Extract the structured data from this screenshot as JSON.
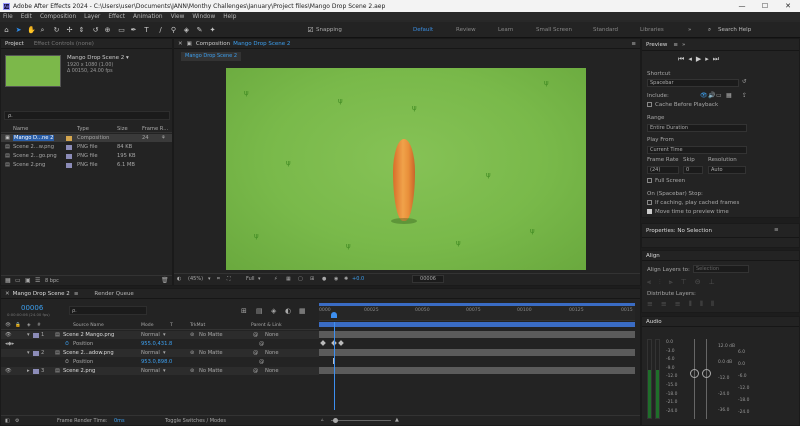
{
  "window": {
    "title": "Adobe After Effects 2024 - C:\\Users\\user\\Documents\\JANN\\Monthy Challenges\\January\\Project files\\Mango Drop Scene 2.aep",
    "app_icon": "Ae",
    "controls": [
      "—",
      "☐",
      "✕"
    ]
  },
  "menu": [
    "File",
    "Edit",
    "Composition",
    "Layer",
    "Effect",
    "Animation",
    "View",
    "Window",
    "Help"
  ],
  "toolbar": {
    "snapping": "Snapping",
    "workspaces": [
      "Default",
      "Review",
      "Learn",
      "Small Screen",
      "Standard",
      "Libraries"
    ],
    "search_placeholder": "Search Help"
  },
  "project": {
    "tab": "Project",
    "effects_tab": "Effect Controls (none)",
    "item_name": "Mango Drop Scene 2 ▾",
    "item_size": "1920 x 1080 (1.00)",
    "item_duration": "Δ 00150, 24.00 fps",
    "search": "ρ.",
    "columns": [
      "Name",
      "Type",
      "Size",
      "Frame R..."
    ],
    "items": [
      {
        "name": "Mango D...ne 2",
        "type": "Composition",
        "size": "",
        "rate": "24"
      },
      {
        "name": "Scene 2...w.png",
        "type": "PNG file",
        "size": "84 KB",
        "rate": ""
      },
      {
        "name": "Scene 2...go.png",
        "type": "PNG file",
        "size": "195 KB",
        "rate": ""
      },
      {
        "name": "Scene 2.png",
        "type": "PNG file",
        "size": "6.1 MB",
        "rate": ""
      }
    ],
    "bpc": "8 bpc"
  },
  "composition": {
    "panel_title": "Composition",
    "comp_name": "Mango Drop Scene 2",
    "tab": "Mango Drop Scene 2",
    "zoom": "(45%)",
    "resolution": "Full",
    "exposure": "+0.0",
    "timecode": "00006"
  },
  "preview": {
    "title": "Preview",
    "shortcut_label": "Shortcut",
    "shortcut_value": "Spacebar",
    "include_label": "Include:",
    "cache_label": "Cache Before Playback",
    "range_label": "Range",
    "range_value": "Entire Duration",
    "play_from_label": "Play From",
    "play_from_value": "Current Time",
    "frame_rate_label": "Frame Rate",
    "frame_rate_value": "(24)",
    "skip_label": "Skip",
    "skip_value": "0",
    "resolution_label": "Resolution",
    "resolution_value": "Auto",
    "full_screen": "Full Screen",
    "on_stop": "On (Spacebar) Stop:",
    "if_caching": "If caching, play cached frames",
    "move_time": "Move time to preview time"
  },
  "properties": {
    "title": "Properties: No Selection"
  },
  "align": {
    "title": "Align",
    "align_to_label": "Align Layers to:",
    "align_to_value": "Selection",
    "distribute_label": "Distribute Layers:"
  },
  "audio": {
    "title": "Audio",
    "left_scale": [
      "0.0",
      "-3.0",
      "-6.0",
      "-9.0",
      "-12.0",
      "-15.0",
      "-18.0",
      "-21.0",
      "-24.0"
    ],
    "right_scale": [
      "12.0 dB",
      "0.0 dB",
      "-12.0",
      "-24.0",
      "-36.0",
      "-48.0 dB"
    ],
    "right_scale_b": [
      "6.0",
      "0.0",
      "-6.0",
      "-12.0",
      "-18.0",
      "-24.0"
    ]
  },
  "timeline": {
    "tab": "Mango Drop Scene 2",
    "render_queue": "Render Queue",
    "timecode": "00006",
    "timecode_sub": "0:00:00:06 (24.00 fps)",
    "search": "ρ.",
    "columns": [
      "Source Name",
      "Mode",
      "T",
      "TrkMat",
      "Parent & Link"
    ],
    "layers": [
      {
        "num": "1",
        "name": "Scene 2 Mango.png",
        "mode": "Normal",
        "matte": "No Matte",
        "parent": "None"
      },
      {
        "num": "2",
        "name": "Scene 2...adow.png",
        "mode": "Normal",
        "matte": "No Matte",
        "parent": "None"
      },
      {
        "num": "3",
        "name": "Scene 2.png",
        "mode": "Normal",
        "matte": "No Matte",
        "parent": "None"
      }
    ],
    "props": [
      {
        "name": "Position",
        "value": "955.0,431.8"
      },
      {
        "name": "Position",
        "value": "953.0,898.0"
      }
    ],
    "ruler": [
      "0000",
      "00025",
      "00050",
      "00075",
      "00100",
      "00125",
      "0015"
    ],
    "footer_render_label": "Frame Render Time:",
    "footer_render_value": "0ms",
    "footer_toggle": "Toggle Switches / Modes"
  },
  "colors": {
    "accent": "#2d8ceb",
    "grass": "#79b94a",
    "mango": "#e58a3a",
    "track": "#5b5b5b"
  }
}
